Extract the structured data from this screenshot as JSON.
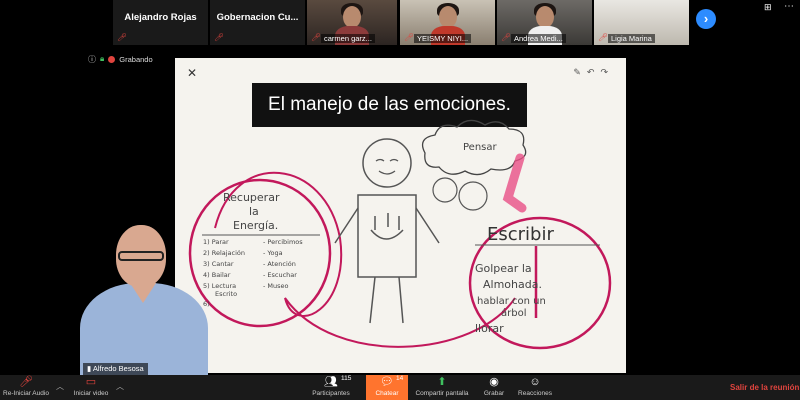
{
  "participants": [
    {
      "name": "Alejandro Rojas",
      "type": "name"
    },
    {
      "name": "Gobernacion  Cu...",
      "type": "name"
    },
    {
      "name": "carmen garz...",
      "type": "video"
    },
    {
      "name": "YEISMY NIYI...",
      "type": "video"
    },
    {
      "name": "Andrea Medi...",
      "type": "video"
    },
    {
      "name": "Ligia Marina",
      "type": "video"
    }
  ],
  "recording": {
    "label": "Grabando"
  },
  "board": {
    "title": "El manejo de las emociones.",
    "left_circle": {
      "heading": [
        "Recuperar",
        "la",
        "Energía."
      ],
      "col1": [
        "1) Parar",
        "2) Relajación",
        "3) Cantar",
        "4) Bailar",
        "5) Lectura",
        "6)"
      ],
      "col1_extra": "Escrito",
      "col2": [
        "- Percibimos",
        "- Yoga",
        "- Atención",
        "- Escuchar",
        "- Museo"
      ]
    },
    "thought_bubble": "Pensar",
    "right_circle": {
      "heading": "Escribir",
      "items": [
        "Golpear la",
        "Almohada.",
        "hablar con un",
        "árbol",
        "llorar"
      ]
    }
  },
  "speaker": {
    "name": "Alfredo Besosa"
  },
  "toolbar": {
    "audio": "Re-Iniciar Audio",
    "video": "Iniciar video",
    "participants": "Participantes",
    "participants_count": "115",
    "chat": "Chatear",
    "chat_count": "14",
    "share": "Compartir pantalla",
    "record": "Grabar",
    "reactions": "Reacciones",
    "leave": "Salir de la reunión"
  },
  "colors": {
    "accent": "#2d8cff",
    "chat_active": "#ff742e",
    "leave": "#e0443e",
    "marker_red": "#c2185b"
  }
}
